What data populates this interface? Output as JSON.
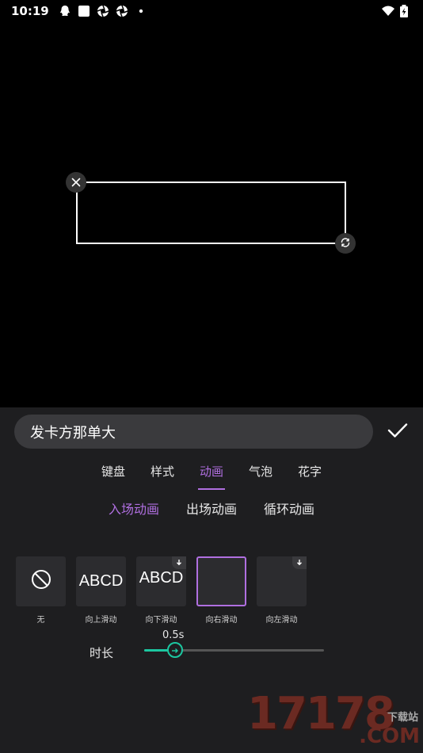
{
  "status": {
    "time": "10:19",
    "icons_left": [
      "qq-icon",
      "square-app-icon",
      "aperture-icon",
      "aperture-icon",
      "dot-icon"
    ],
    "icons_right": [
      "wifi-icon",
      "battery-charging-icon"
    ]
  },
  "editor": {
    "text_value": "发卡方那单大"
  },
  "tabs": [
    {
      "label": "键盘",
      "active": false
    },
    {
      "label": "样式",
      "active": false
    },
    {
      "label": "动画",
      "active": true
    },
    {
      "label": "气泡",
      "active": false
    },
    {
      "label": "花字",
      "active": false
    }
  ],
  "subtabs": [
    {
      "label": "入场动画",
      "active": true
    },
    {
      "label": "出场动画",
      "active": false
    },
    {
      "label": "循环动画",
      "active": false
    }
  ],
  "animations": [
    {
      "label": "无",
      "tile_text": "",
      "icon": "no-entry-icon",
      "download": false,
      "selected": false
    },
    {
      "label": "向上滑动",
      "tile_text": "ABCD",
      "icon": "",
      "download": false,
      "selected": false
    },
    {
      "label": "向下滑动",
      "tile_text": "ABCD",
      "icon": "",
      "download": true,
      "selected": false
    },
    {
      "label": "向右滑动",
      "tile_text": "",
      "icon": "",
      "download": false,
      "selected": true
    },
    {
      "label": "向左滑动",
      "tile_text": "",
      "icon": "",
      "download": true,
      "selected": false
    }
  ],
  "duration": {
    "label": "时长",
    "value_text": "0.5s",
    "fraction": 0.17
  },
  "watermark": {
    "number": "17178",
    "small": "下载站",
    "com": ".COM"
  },
  "colors": {
    "accent": "#b06fe0",
    "slider": "#1cc7a0",
    "panel": "#1e1e20"
  }
}
